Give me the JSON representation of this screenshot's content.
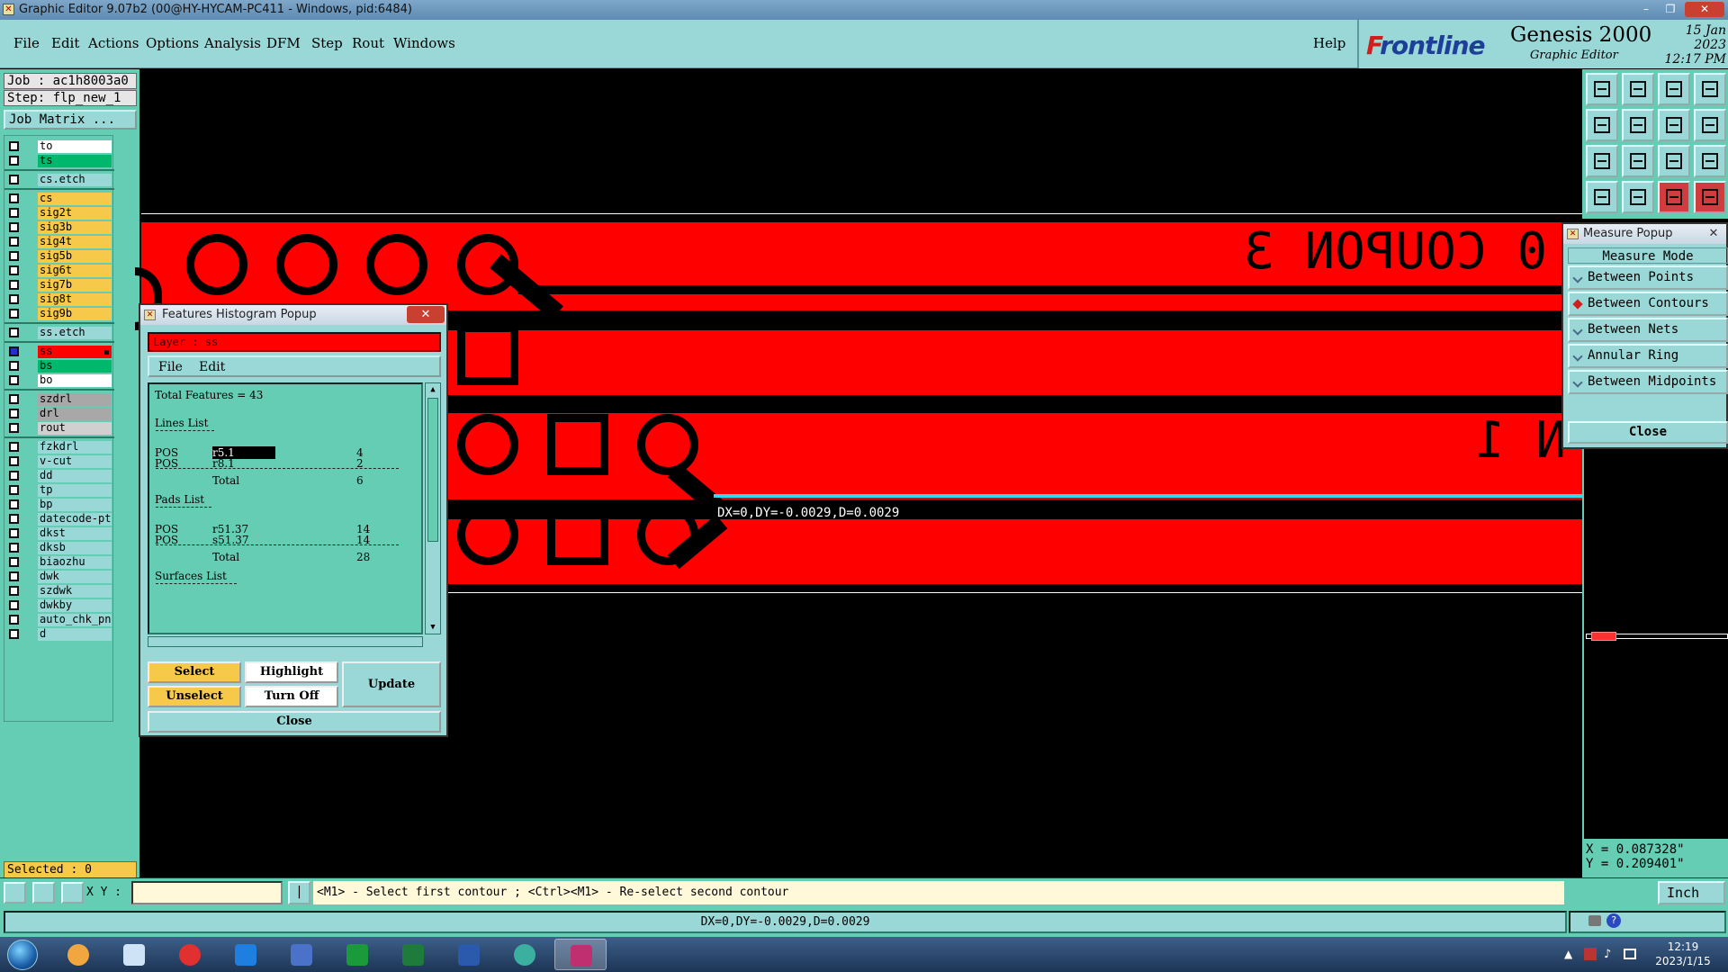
{
  "window": {
    "title": "Graphic Editor 9.07b2 (00@HY-HYCAM-PC411 - Windows, pid:6484)"
  },
  "menu": {
    "items": [
      "File",
      "Edit",
      "Actions",
      "Options",
      "Analysis",
      "DFM",
      "Step",
      "Rout",
      "Windows"
    ],
    "help": "Help"
  },
  "brand": {
    "logo_prefix": "F",
    "logo_rest": "rontline",
    "product": "Genesis 2000",
    "subtitle": "Graphic Editor",
    "date_line1": "15 Jan 2023",
    "date_line2": "12:17 PM"
  },
  "left": {
    "job": "Job  : ac1h8003a0",
    "step": "Step: flp_new_1",
    "job_matrix": "Job Matrix ...",
    "selected": "Selected : 0",
    "layers": [
      {
        "name": "to",
        "color": "#ffffff"
      },
      {
        "name": "ts",
        "color": "#00b86b"
      },
      {
        "name": "cs.etch",
        "color": "#9ad8d8",
        "sep_before": true
      },
      {
        "name": "cs",
        "color": "#f6c94a",
        "sep_before": true
      },
      {
        "name": "sig2t",
        "color": "#f6c94a"
      },
      {
        "name": "sig3b",
        "color": "#f6c94a"
      },
      {
        "name": "sig4t",
        "color": "#f6c94a"
      },
      {
        "name": "sig5b",
        "color": "#f6c94a"
      },
      {
        "name": "sig6t",
        "color": "#f6c94a"
      },
      {
        "name": "sig7b",
        "color": "#f6c94a"
      },
      {
        "name": "sig8t",
        "color": "#f6c94a"
      },
      {
        "name": "sig9b",
        "color": "#f6c94a"
      },
      {
        "name": "ss.etch",
        "color": "#9ad8d8",
        "sep_before": true
      },
      {
        "name": "ss",
        "color": "#ff0000",
        "sep_before": true,
        "active": true
      },
      {
        "name": "bs",
        "color": "#00b86b"
      },
      {
        "name": "bo",
        "color": "#ffffff"
      },
      {
        "name": "szdrl",
        "color": "#a8a8a8",
        "sep_before": true
      },
      {
        "name": "drl",
        "color": "#a8a8a8"
      },
      {
        "name": "rout",
        "color": "#d0d0d0"
      },
      {
        "name": "fzkdrl",
        "color": "#9ad8d8",
        "sep_before": true
      },
      {
        "name": "v-cut",
        "color": "#9ad8d8"
      },
      {
        "name": "dd",
        "color": "#9ad8d8"
      },
      {
        "name": "tp",
        "color": "#9ad8d8"
      },
      {
        "name": "bp",
        "color": "#9ad8d8"
      },
      {
        "name": "datecode-pto",
        "color": "#9ad8d8"
      },
      {
        "name": "dkst",
        "color": "#9ad8d8"
      },
      {
        "name": "dksb",
        "color": "#9ad8d8"
      },
      {
        "name": "biaozhu",
        "color": "#9ad8d8"
      },
      {
        "name": "dwk",
        "color": "#9ad8d8"
      },
      {
        "name": "szdwk",
        "color": "#9ad8d8"
      },
      {
        "name": "dwkby",
        "color": "#9ad8d8"
      },
      {
        "name": "auto_chk_pnl",
        "color": "#9ad8d8"
      },
      {
        "name": "d",
        "color": "#9ad8d8"
      }
    ]
  },
  "canvas": {
    "coupon_top_text": "0 COUPON 3",
    "coupon_bottom_text": "N 1",
    "measure_label": "DX=0,DY=-0.0029,D=0.0029"
  },
  "histogram": {
    "title": "Features Histogram Popup",
    "layer": "Layer :  ss",
    "menu_file": "File",
    "menu_edit": "Edit",
    "total_features": "Total Features = 43",
    "lines_header": "Lines List",
    "lines": [
      {
        "pol": "POS",
        "sym": "r5.1",
        "count": "4"
      },
      {
        "pol": "POS",
        "sym": "r8.1",
        "count": "2"
      }
    ],
    "lines_total_label": "Total",
    "lines_total": "6",
    "pads_header": "Pads List",
    "pads": [
      {
        "pol": "POS",
        "sym": "r51.37",
        "count": "14"
      },
      {
        "pol": "POS",
        "sym": "s51.37",
        "count": "14"
      }
    ],
    "pads_total_label": "Total",
    "pads_total": "28",
    "surfaces_header": "Surfaces List",
    "btn_select": "Select",
    "btn_highlight": "Highlight",
    "btn_unselect": "Unselect",
    "btn_turnoff": "Turn Off",
    "btn_update": "Update",
    "btn_close": "Close"
  },
  "measure": {
    "title": "Measure Popup",
    "mode_header": "Measure Mode",
    "options": [
      {
        "label": "Between Points",
        "selected": false
      },
      {
        "label": "Between Contours",
        "selected": true
      },
      {
        "label": "Between Nets",
        "selected": false
      },
      {
        "label": "Annular Ring",
        "selected": false
      },
      {
        "label": "Between Midpoints",
        "selected": false
      }
    ],
    "close": "Close"
  },
  "coords": {
    "x": "X = 0.087328\"",
    "y": "Y = 0.209401\""
  },
  "bottom": {
    "xy_label": "X Y :",
    "prompt": "<M1> - Select first contour ; <Ctrl><M1> - Re-select second contour",
    "unit": "Inch",
    "status": "DX=0,DY=-0.0029,D=0.0029"
  },
  "taskbar": {
    "time": "12:19",
    "date": "2023/1/15"
  }
}
